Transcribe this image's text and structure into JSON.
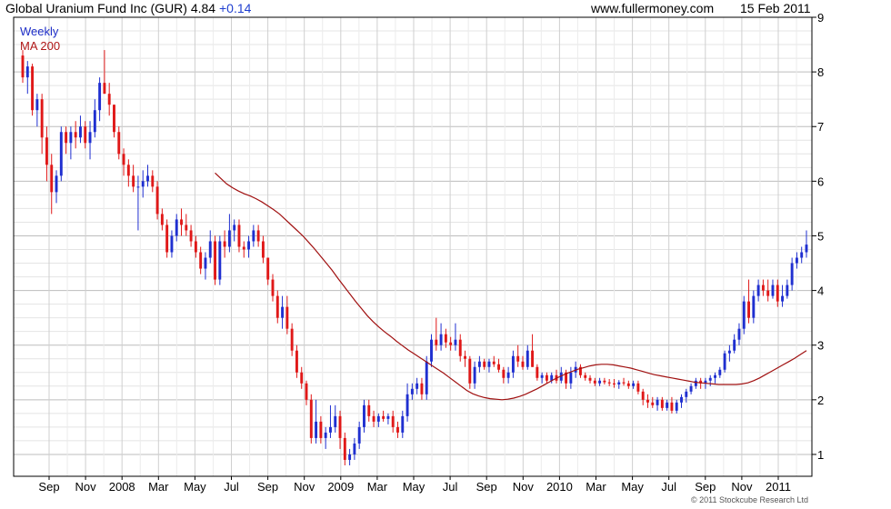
{
  "header": {
    "title": "Global Uranium Fund Inc (GUR) 4.84",
    "change": "+0.14",
    "source": "www.fullermoney.com",
    "date": "15 Feb 2011"
  },
  "legend": {
    "weekly": "Weekly",
    "ma": "MA 200"
  },
  "copyright": "© 2011 Stockcube Research Ltd",
  "colors": {
    "up": "#1f2fd0",
    "down": "#e01818",
    "ma": "#a01010",
    "grid": "#d4d4d4",
    "axis": "#000000"
  },
  "chart_data": {
    "type": "candlestick",
    "title": "Global Uranium Fund Inc (GUR)",
    "x_tick_labels": [
      "Sep",
      "Nov",
      "2008",
      "Mar",
      "May",
      "Jul",
      "Sep",
      "Nov",
      "2009",
      "Mar",
      "May",
      "Jul",
      "Sep",
      "Nov",
      "2010",
      "Mar",
      "May",
      "Jul",
      "Sep",
      "Nov",
      "2011"
    ],
    "y_ticks": [
      1,
      2,
      3,
      4,
      5,
      6,
      7,
      8,
      9
    ],
    "ylim": [
      0.6,
      9.0
    ],
    "grid": true,
    "series": [
      {
        "name": "Weekly",
        "style": "candles",
        "ohlc": [
          [
            8.3,
            8.4,
            7.8,
            7.9
          ],
          [
            7.9,
            8.2,
            7.6,
            8.1
          ],
          [
            8.1,
            8.15,
            7.2,
            7.3
          ],
          [
            7.3,
            7.6,
            7.0,
            7.5
          ],
          [
            7.5,
            7.6,
            6.5,
            6.8
          ],
          [
            6.8,
            7.0,
            6.0,
            6.3
          ],
          [
            6.3,
            6.5,
            5.4,
            5.8
          ],
          [
            5.8,
            6.2,
            5.6,
            6.1
          ],
          [
            6.1,
            7.0,
            6.0,
            6.9
          ],
          [
            6.9,
            7.0,
            6.5,
            6.7
          ],
          [
            6.7,
            7.0,
            6.4,
            6.9
          ],
          [
            6.9,
            7.1,
            6.6,
            6.8
          ],
          [
            6.8,
            7.2,
            6.7,
            7.0
          ],
          [
            7.0,
            7.1,
            6.6,
            6.7
          ],
          [
            6.7,
            7.1,
            6.4,
            6.9
          ],
          [
            6.9,
            7.5,
            6.8,
            7.3
          ],
          [
            7.3,
            7.9,
            7.1,
            7.8
          ],
          [
            7.8,
            8.4,
            7.6,
            7.6
          ],
          [
            7.6,
            7.8,
            7.2,
            7.4
          ],
          [
            7.4,
            7.4,
            6.8,
            6.9
          ],
          [
            6.9,
            7.0,
            6.4,
            6.5
          ],
          [
            6.5,
            6.6,
            6.1,
            6.3
          ],
          [
            6.3,
            6.4,
            5.9,
            6.1
          ],
          [
            6.1,
            6.3,
            5.8,
            5.9
          ],
          [
            5.9,
            6.1,
            5.1,
            5.9
          ],
          [
            5.9,
            6.2,
            5.7,
            6.0
          ],
          [
            6.0,
            6.3,
            5.9,
            6.1
          ],
          [
            6.1,
            6.2,
            5.8,
            5.9
          ],
          [
            5.9,
            6.0,
            5.3,
            5.4
          ],
          [
            5.4,
            5.5,
            5.1,
            5.2
          ],
          [
            5.2,
            5.3,
            4.6,
            4.7
          ],
          [
            4.7,
            5.1,
            4.6,
            5.0
          ],
          [
            5.0,
            5.4,
            4.9,
            5.3
          ],
          [
            5.3,
            5.5,
            5.0,
            5.2
          ],
          [
            5.2,
            5.4,
            5.0,
            5.1
          ],
          [
            5.1,
            5.2,
            4.8,
            4.9
          ],
          [
            4.9,
            5.0,
            4.6,
            4.7
          ],
          [
            4.7,
            4.8,
            4.3,
            4.4
          ],
          [
            4.4,
            4.7,
            4.2,
            4.6
          ],
          [
            4.6,
            5.1,
            4.5,
            4.9
          ],
          [
            4.9,
            5.0,
            4.1,
            4.2
          ],
          [
            4.2,
            5.0,
            4.1,
            4.9
          ],
          [
            4.9,
            5.1,
            4.6,
            4.8
          ],
          [
            4.8,
            5.4,
            4.7,
            5.1
          ],
          [
            5.1,
            5.3,
            4.9,
            5.2
          ],
          [
            5.2,
            5.3,
            4.7,
            4.8
          ],
          [
            4.8,
            4.9,
            4.6,
            4.75
          ],
          [
            4.75,
            5.0,
            4.6,
            4.9
          ],
          [
            4.9,
            5.2,
            4.8,
            5.1
          ],
          [
            5.1,
            5.2,
            4.8,
            4.9
          ],
          [
            4.9,
            5.0,
            4.5,
            4.6
          ],
          [
            4.6,
            4.6,
            4.1,
            4.2
          ],
          [
            4.2,
            4.3,
            3.8,
            3.9
          ],
          [
            3.9,
            4.0,
            3.4,
            3.5
          ],
          [
            3.5,
            3.9,
            3.3,
            3.7
          ],
          [
            3.7,
            3.9,
            3.2,
            3.3
          ],
          [
            3.3,
            3.4,
            2.8,
            2.9
          ],
          [
            2.9,
            3.0,
            2.4,
            2.5
          ],
          [
            2.5,
            2.6,
            2.2,
            2.3
          ],
          [
            2.3,
            2.35,
            1.9,
            2.0
          ],
          [
            2.0,
            2.1,
            1.2,
            1.3
          ],
          [
            1.3,
            2.0,
            1.2,
            1.6
          ],
          [
            1.6,
            1.7,
            1.2,
            1.3
          ],
          [
            1.3,
            1.5,
            1.1,
            1.4
          ],
          [
            1.4,
            1.9,
            1.3,
            1.5
          ],
          [
            1.5,
            1.9,
            1.4,
            1.7
          ],
          [
            1.7,
            1.8,
            1.1,
            1.3
          ],
          [
            1.3,
            1.4,
            0.8,
            0.9
          ],
          [
            0.9,
            1.1,
            0.8,
            1.0
          ],
          [
            1.0,
            1.3,
            0.9,
            1.2
          ],
          [
            1.2,
            1.6,
            1.1,
            1.5
          ],
          [
            1.5,
            2.0,
            1.4,
            1.9
          ],
          [
            1.9,
            2.0,
            1.6,
            1.7
          ],
          [
            1.7,
            1.8,
            1.5,
            1.6
          ],
          [
            1.6,
            1.75,
            1.5,
            1.7
          ],
          [
            1.7,
            1.8,
            1.6,
            1.65
          ],
          [
            1.65,
            1.75,
            1.55,
            1.7
          ],
          [
            1.7,
            1.8,
            1.4,
            1.5
          ],
          [
            1.5,
            1.6,
            1.3,
            1.4
          ],
          [
            1.4,
            1.8,
            1.3,
            1.7
          ],
          [
            1.7,
            2.3,
            1.6,
            2.1
          ],
          [
            2.1,
            2.3,
            2.0,
            2.2
          ],
          [
            2.2,
            2.4,
            2.1,
            2.3
          ],
          [
            2.3,
            2.4,
            2.0,
            2.1
          ],
          [
            2.1,
            2.8,
            2.0,
            2.7
          ],
          [
            2.7,
            3.2,
            2.6,
            3.1
          ],
          [
            3.1,
            3.5,
            2.9,
            3.0
          ],
          [
            3.0,
            3.4,
            2.9,
            3.2
          ],
          [
            3.2,
            3.3,
            2.95,
            3.05
          ],
          [
            3.05,
            3.15,
            2.9,
            3.0
          ],
          [
            3.0,
            3.4,
            2.9,
            3.1
          ],
          [
            3.1,
            3.2,
            2.7,
            2.8
          ],
          [
            2.8,
            2.9,
            2.6,
            2.75
          ],
          [
            2.75,
            2.8,
            2.2,
            2.3
          ],
          [
            2.3,
            2.7,
            2.2,
            2.6
          ],
          [
            2.6,
            2.8,
            2.5,
            2.7
          ],
          [
            2.7,
            2.75,
            2.55,
            2.6
          ],
          [
            2.6,
            2.75,
            2.5,
            2.7
          ],
          [
            2.7,
            2.8,
            2.6,
            2.65
          ],
          [
            2.65,
            2.75,
            2.5,
            2.55
          ],
          [
            2.55,
            2.6,
            2.3,
            2.4
          ],
          [
            2.4,
            2.6,
            2.3,
            2.5
          ],
          [
            2.5,
            2.9,
            2.4,
            2.8
          ],
          [
            2.8,
            3.0,
            2.6,
            2.7
          ],
          [
            2.7,
            2.8,
            2.55,
            2.6
          ],
          [
            2.6,
            3.0,
            2.55,
            2.9
          ],
          [
            2.9,
            3.2,
            2.6,
            2.6
          ],
          [
            2.6,
            2.65,
            2.35,
            2.4
          ],
          [
            2.4,
            2.5,
            2.3,
            2.45
          ],
          [
            2.45,
            2.5,
            2.3,
            2.35
          ],
          [
            2.35,
            2.5,
            2.3,
            2.45
          ],
          [
            2.45,
            2.55,
            2.3,
            2.35
          ],
          [
            2.35,
            2.6,
            2.3,
            2.5
          ],
          [
            2.5,
            2.55,
            2.2,
            2.3
          ],
          [
            2.3,
            2.6,
            2.2,
            2.5
          ],
          [
            2.5,
            2.7,
            2.4,
            2.6
          ],
          [
            2.6,
            2.65,
            2.4,
            2.45
          ],
          [
            2.45,
            2.5,
            2.35,
            2.4
          ],
          [
            2.4,
            2.45,
            2.3,
            2.35
          ],
          [
            2.35,
            2.4,
            2.25,
            2.3
          ],
          [
            2.3,
            2.4,
            2.25,
            2.35
          ],
          [
            2.35,
            2.4,
            2.28,
            2.32
          ],
          [
            2.32,
            2.38,
            2.25,
            2.3
          ],
          [
            2.3,
            2.38,
            2.22,
            2.28
          ],
          [
            2.28,
            2.36,
            2.2,
            2.32
          ],
          [
            2.32,
            2.4,
            2.26,
            2.3
          ],
          [
            2.3,
            2.35,
            2.2,
            2.25
          ],
          [
            2.25,
            2.35,
            2.2,
            2.3
          ],
          [
            2.3,
            2.35,
            2.1,
            2.15
          ],
          [
            2.15,
            2.2,
            1.9,
            2.0
          ],
          [
            2.0,
            2.1,
            1.85,
            1.95
          ],
          [
            1.95,
            2.05,
            1.85,
            1.9
          ],
          [
            1.9,
            2.05,
            1.8,
            2.0
          ],
          [
            2.0,
            2.05,
            1.8,
            1.85
          ],
          [
            1.85,
            2.0,
            1.8,
            1.95
          ],
          [
            1.95,
            2.05,
            1.75,
            1.8
          ],
          [
            1.8,
            2.0,
            1.75,
            1.95
          ],
          [
            1.95,
            2.1,
            1.85,
            2.05
          ],
          [
            2.05,
            2.2,
            1.95,
            2.15
          ],
          [
            2.15,
            2.3,
            2.1,
            2.25
          ],
          [
            2.25,
            2.4,
            2.2,
            2.35
          ],
          [
            2.35,
            2.4,
            2.2,
            2.3
          ],
          [
            2.3,
            2.4,
            2.2,
            2.35
          ],
          [
            2.35,
            2.45,
            2.25,
            2.4
          ],
          [
            2.4,
            2.5,
            2.3,
            2.45
          ],
          [
            2.45,
            2.6,
            2.4,
            2.55
          ],
          [
            2.55,
            2.9,
            2.5,
            2.85
          ],
          [
            2.85,
            3.0,
            2.7,
            2.9
          ],
          [
            2.9,
            3.2,
            2.85,
            3.1
          ],
          [
            3.1,
            3.4,
            3.0,
            3.3
          ],
          [
            3.3,
            3.9,
            3.2,
            3.8
          ],
          [
            3.8,
            4.2,
            3.4,
            3.5
          ],
          [
            3.5,
            4.0,
            3.4,
            3.9
          ],
          [
            3.9,
            4.2,
            3.8,
            4.1
          ],
          [
            4.1,
            4.2,
            3.9,
            4.0
          ],
          [
            4.0,
            4.2,
            3.8,
            3.9
          ],
          [
            3.9,
            4.2,
            3.85,
            4.1
          ],
          [
            4.1,
            4.2,
            3.7,
            3.8
          ],
          [
            3.8,
            4.1,
            3.7,
            3.9
          ],
          [
            3.9,
            4.2,
            3.85,
            4.1
          ],
          [
            4.1,
            4.6,
            4.0,
            4.5
          ],
          [
            4.5,
            4.7,
            4.4,
            4.6
          ],
          [
            4.6,
            4.8,
            4.5,
            4.7
          ],
          [
            4.7,
            5.1,
            4.6,
            4.84
          ]
        ]
      },
      {
        "name": "MA 200",
        "style": "line",
        "start_week": 40,
        "values": [
          6.15,
          6.05,
          5.95,
          5.88,
          5.82,
          5.77,
          5.73,
          5.68,
          5.62,
          5.55,
          5.48,
          5.4,
          5.3,
          5.2,
          5.1,
          5.0,
          4.88,
          4.76,
          4.63,
          4.5,
          4.37,
          4.22,
          4.08,
          3.94,
          3.8,
          3.67,
          3.54,
          3.43,
          3.33,
          3.24,
          3.16,
          3.07,
          2.99,
          2.91,
          2.84,
          2.77,
          2.7,
          2.63,
          2.56,
          2.49,
          2.41,
          2.33,
          2.25,
          2.17,
          2.11,
          2.07,
          2.04,
          2.02,
          2.01,
          2.0,
          2.01,
          2.03,
          2.06,
          2.1,
          2.15,
          2.2,
          2.26,
          2.32,
          2.38,
          2.43,
          2.48,
          2.52,
          2.56,
          2.59,
          2.62,
          2.64,
          2.65,
          2.65,
          2.64,
          2.62,
          2.6,
          2.58,
          2.55,
          2.52,
          2.49,
          2.46,
          2.44,
          2.42,
          2.4,
          2.38,
          2.36,
          2.34,
          2.32,
          2.31,
          2.3,
          2.29,
          2.28,
          2.28,
          2.28,
          2.28,
          2.29,
          2.31,
          2.35,
          2.4,
          2.46,
          2.52,
          2.58,
          2.64,
          2.7,
          2.76,
          2.83,
          2.9
        ]
      }
    ]
  }
}
